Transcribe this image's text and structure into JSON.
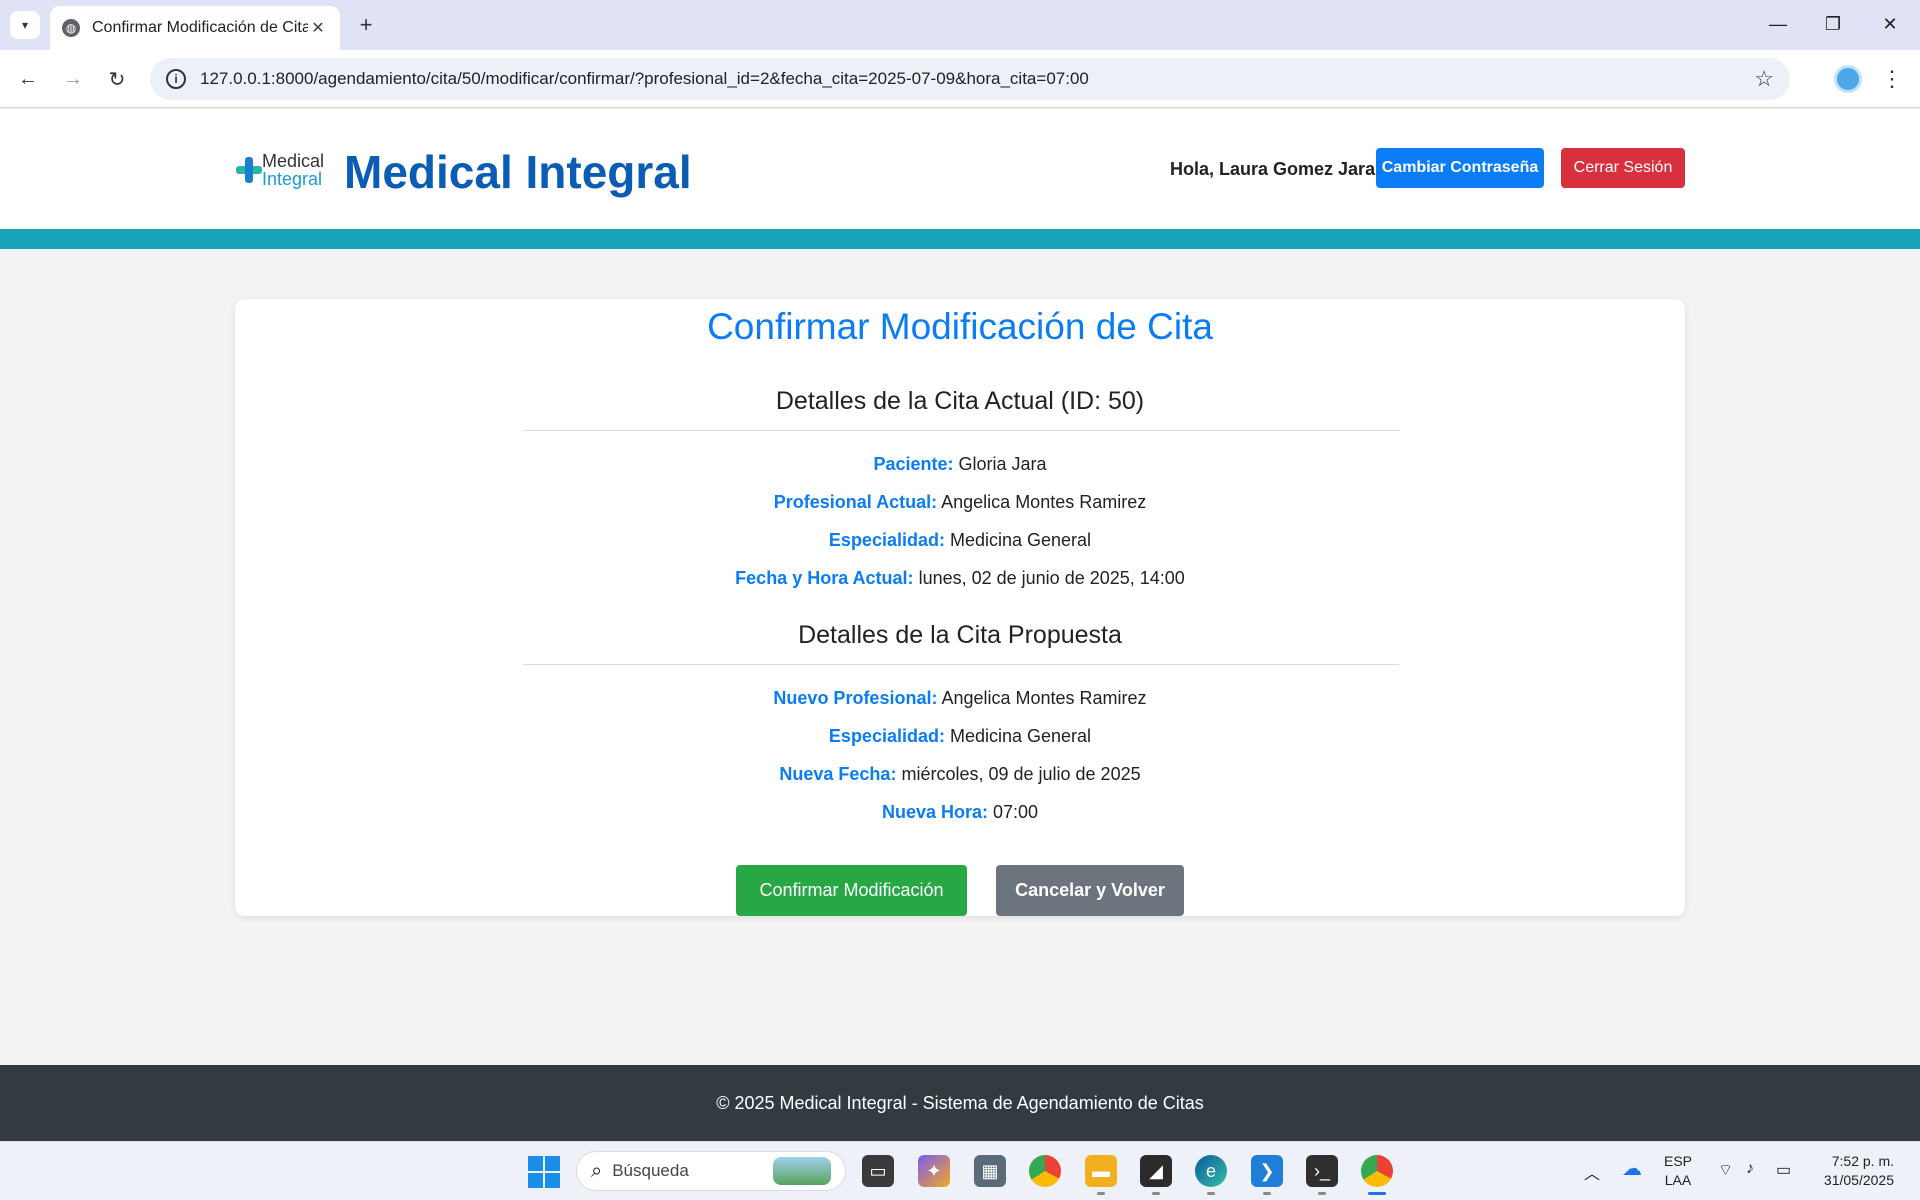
{
  "browser": {
    "tab_title": "Confirmar Modificación de Cita",
    "url": "127.0.0.1:8000/agendamiento/cita/50/modificar/confirmar/?profesional_id=2&fecha_cita=2025-07-09&hora_cita=07:00"
  },
  "header": {
    "logo_line1": "Medical",
    "logo_line2": "Integral",
    "brand": "Medical Integral",
    "greeting": "Hola, Laura Gomez Jara",
    "change_password": "Cambiar Contraseña",
    "logout": "Cerrar Sesión"
  },
  "main": {
    "title": "Confirmar Modificación de Cita",
    "current": {
      "heading": "Detalles de la Cita Actual (ID: 50)",
      "fields": [
        {
          "label": "Paciente:",
          "value": "Gloria Jara"
        },
        {
          "label": "Profesional Actual:",
          "value": "Angelica Montes Ramirez"
        },
        {
          "label": "Especialidad:",
          "value": "Medicina General"
        },
        {
          "label": "Fecha y Hora Actual:",
          "value": "lunes, 02 de junio de 2025, 14:00"
        }
      ]
    },
    "proposed": {
      "heading": "Detalles de la Cita Propuesta",
      "fields": [
        {
          "label": "Nuevo Profesional:",
          "value": "Angelica Montes Ramirez"
        },
        {
          "label": "Especialidad:",
          "value": "Medicina General"
        },
        {
          "label": "Nueva Fecha:",
          "value": "miércoles, 09 de julio de 2025"
        },
        {
          "label": "Nueva Hora:",
          "value": "07:00"
        }
      ]
    },
    "confirm_button": "Confirmar Modificación",
    "cancel_button": "Cancelar y Volver"
  },
  "footer": {
    "text": "© 2025 Medical Integral - Sistema de Agendamiento de Citas"
  },
  "taskbar": {
    "search_placeholder": "Búsqueda",
    "lang_line1": "ESP",
    "lang_line2": "LAA",
    "time": "7:52 p. m.",
    "date": "31/05/2025"
  },
  "colors": {
    "accent": "#0a7cf5",
    "brand": "#0b5cb5",
    "teal": "#17a2b8",
    "confirm": "#28a745",
    "cancel": "#6c757d",
    "logout": "#d9303e",
    "footer": "#333a40"
  }
}
